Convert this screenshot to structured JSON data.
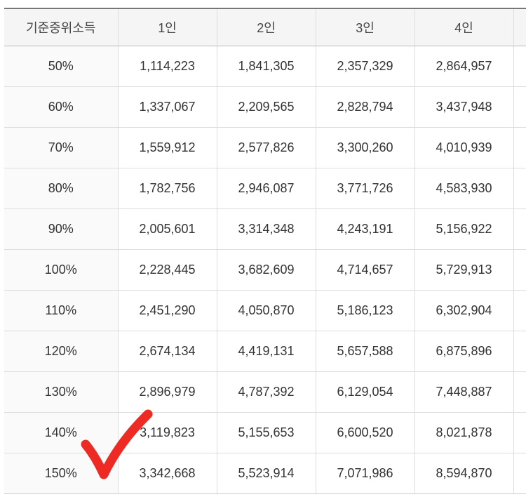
{
  "table": {
    "headers": [
      "기준중위소득",
      "1인",
      "2인",
      "3인",
      "4인"
    ],
    "rows": [
      [
        "50%",
        "1,114,223",
        "1,841,305",
        "2,357,329",
        "2,864,957"
      ],
      [
        "60%",
        "1,337,067",
        "2,209,565",
        "2,828,794",
        "3,437,948"
      ],
      [
        "70%",
        "1,559,912",
        "2,577,826",
        "3,300,260",
        "4,010,939"
      ],
      [
        "80%",
        "1,782,756",
        "2,946,087",
        "3,771,726",
        "4,583,930"
      ],
      [
        "90%",
        "2,005,601",
        "3,314,348",
        "4,243,191",
        "5,156,922"
      ],
      [
        "100%",
        "2,228,445",
        "3,682,609",
        "4,714,657",
        "5,729,913"
      ],
      [
        "110%",
        "2,451,290",
        "4,050,870",
        "5,186,123",
        "6,302,904"
      ],
      [
        "120%",
        "2,674,134",
        "4,419,131",
        "5,657,588",
        "6,875,896"
      ],
      [
        "130%",
        "2,896,979",
        "4,787,392",
        "6,129,054",
        "7,448,887"
      ],
      [
        "140%",
        "3,119,823",
        "5,155,653",
        "6,600,520",
        "8,021,878"
      ],
      [
        "150%",
        "3,342,668",
        "5,523,914",
        "7,071,986",
        "8,594,870"
      ]
    ]
  },
  "annotation": {
    "icon": "red-checkmark-icon",
    "color": "#ee2a24"
  }
}
